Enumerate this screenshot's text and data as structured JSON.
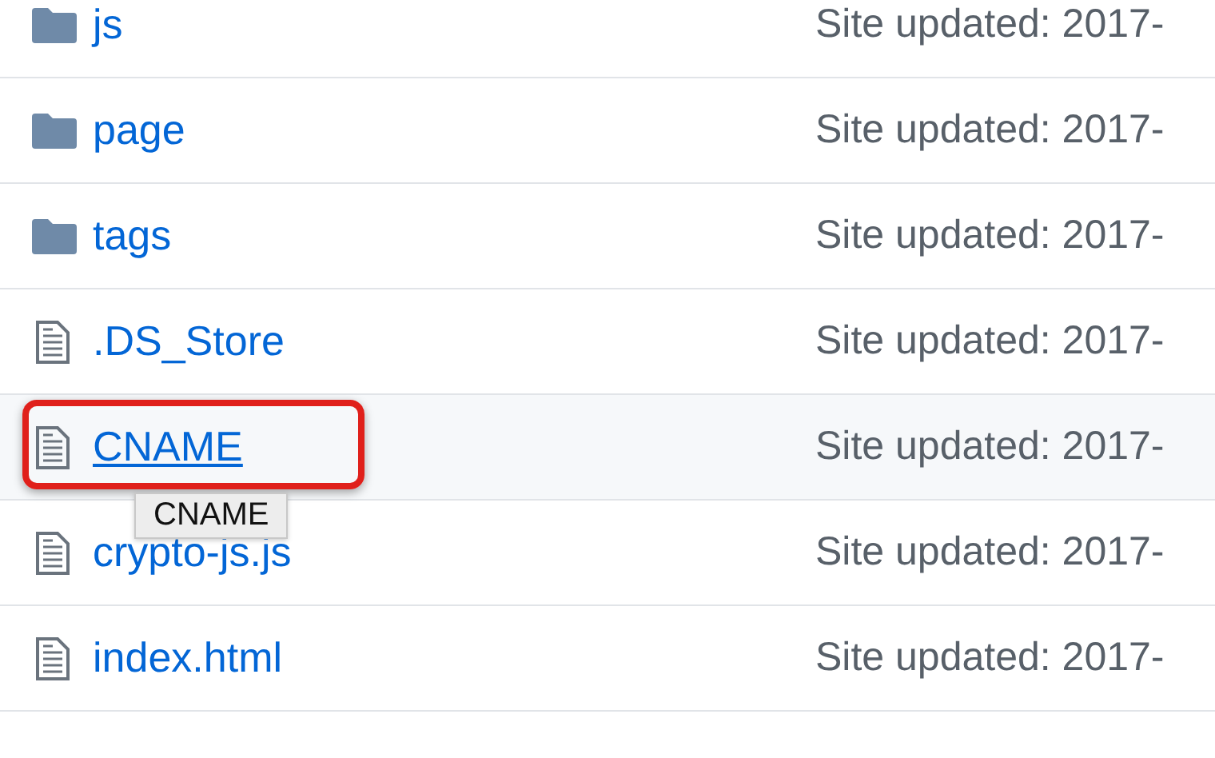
{
  "rows": [
    {
      "kind": "folder",
      "name": "js",
      "message": "Site updated: 2017-",
      "hovered": false,
      "highlighted": false
    },
    {
      "kind": "folder",
      "name": "page",
      "message": "Site updated: 2017-",
      "hovered": false,
      "highlighted": false
    },
    {
      "kind": "folder",
      "name": "tags",
      "message": "Site updated: 2017-",
      "hovered": false,
      "highlighted": false
    },
    {
      "kind": "file",
      "name": ".DS_Store",
      "message": "Site updated: 2017-",
      "hovered": false,
      "highlighted": false
    },
    {
      "kind": "file",
      "name": "CNAME",
      "message": "Site updated: 2017-",
      "hovered": true,
      "highlighted": true
    },
    {
      "kind": "file",
      "name": "crypto-js.js",
      "message": "Site updated: 2017-",
      "hovered": false,
      "highlighted": false
    },
    {
      "kind": "file",
      "name": "index.html",
      "message": "Site updated: 2017-",
      "hovered": false,
      "highlighted": false
    }
  ],
  "tooltip": {
    "text": "CNAME"
  }
}
